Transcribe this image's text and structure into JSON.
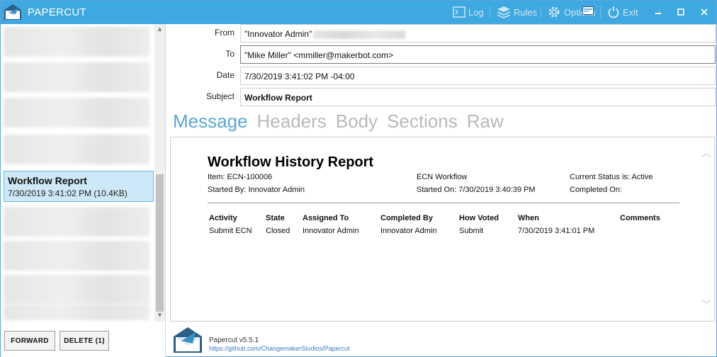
{
  "app": {
    "title": "PAPERCUT",
    "toolbar": {
      "log_label": "Log",
      "rules_label": "Rules",
      "options_label": "Options",
      "exit_label": "Exit"
    }
  },
  "message_list": {
    "selected": {
      "subject": "Workflow Report",
      "meta": "7/30/2019 3:41:02 PM (10.4KB)"
    },
    "buttons": {
      "forward_label": "FORWARD",
      "delete_label": "DELETE (1)"
    }
  },
  "headers": {
    "from_label": "From",
    "from_value": "\"Innovator Admin\"",
    "to_label": "To",
    "to_value": "\"Mike Miller\" <mmiller@makerbot.com>",
    "date_label": "Date",
    "date_value": "7/30/2019 3:41:02 PM -04:00",
    "subject_label": "Subject",
    "subject_value": "Workflow Report"
  },
  "tabs": [
    "Message",
    "Headers",
    "Body",
    "Sections",
    "Raw"
  ],
  "report": {
    "title": "Workflow History Report",
    "item": "Item: ECN-100006",
    "workflow": "ECN Workflow",
    "status": "Current Status is: Active",
    "started_by": "Started By: Innovator Admin",
    "started_on": "Started On: 7/30/2019 3:40:39 PM",
    "completed_on": "Completed On:",
    "columns": [
      "Activity",
      "State",
      "Assigned To",
      "Completed By",
      "How Voted",
      "When",
      "Comments"
    ],
    "rows": [
      [
        "Submit ECN",
        "Closed",
        "Innovator Admin",
        "Innovator Admin",
        "Submit",
        "7/30/2019 3:41:01 PM",
        ""
      ]
    ]
  },
  "footer": {
    "version": "Papercut v5.5.1",
    "url": "https://github.com/ChangemakerStudios/Papercut"
  },
  "colors": {
    "titlebar": "#3ea8e0",
    "accent": "#5aa7d8",
    "selected_bg": "#cde8f6"
  }
}
